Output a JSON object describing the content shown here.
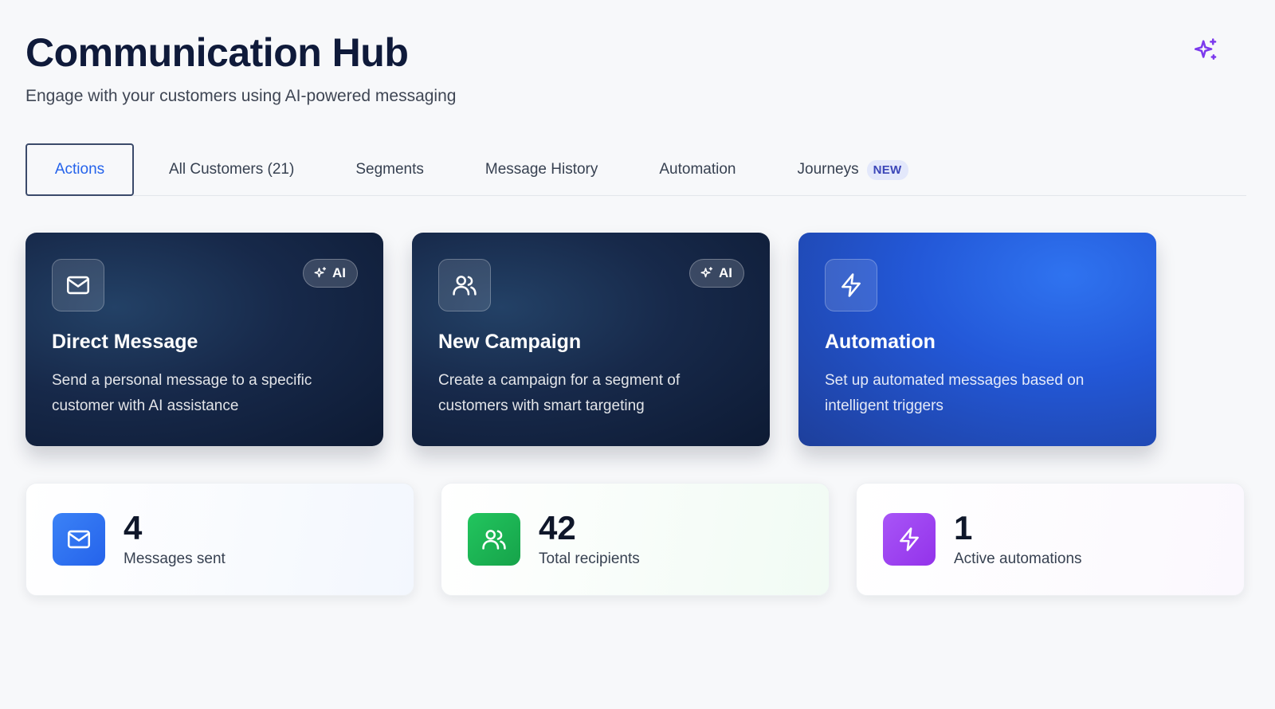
{
  "header": {
    "title": "Communication Hub",
    "subtitle": "Engage with your customers using AI-powered messaging",
    "top_icon": "sparkles-icon"
  },
  "tabs": [
    {
      "label": "Actions",
      "active": true
    },
    {
      "label": "All Customers (21)"
    },
    {
      "label": "Segments"
    },
    {
      "label": "Message History"
    },
    {
      "label": "Automation"
    },
    {
      "label": "Journeys",
      "badge": "NEW"
    }
  ],
  "action_cards": [
    {
      "title": "Direct Message",
      "description": "Send a personal message to a specific customer with AI assistance",
      "badge": "AI",
      "icon": "mail-icon"
    },
    {
      "title": "New Campaign",
      "description": "Create a campaign for a segment of customers with smart targeting",
      "badge": "AI",
      "icon": "users-icon"
    },
    {
      "title": "Automation",
      "description": "Set up automated messages based on intelligent triggers",
      "icon": "lightning-icon"
    }
  ],
  "stats": [
    {
      "value": "4",
      "label": "Messages sent",
      "icon": "mail-icon",
      "color": "#2f6fe8"
    },
    {
      "value": "42",
      "label": "Total recipients",
      "icon": "users-icon",
      "color": "#1faa4f"
    },
    {
      "value": "1",
      "label": "Active automations",
      "icon": "lightning-icon",
      "color": "#9b3fe0"
    }
  ],
  "colors": {
    "accent": "#2563eb",
    "title": "#0f1a3a",
    "sparkle": "#7c3aed"
  }
}
